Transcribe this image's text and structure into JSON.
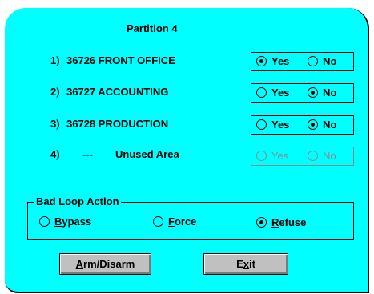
{
  "title": "Partition 4",
  "rows": [
    {
      "num": "1)",
      "label": "36726 FRONT OFFICE",
      "yes": "Yes",
      "no": "No",
      "selected": "yes"
    },
    {
      "num": "2)",
      "label": "36727 ACCOUNTING",
      "yes": "Yes",
      "no": "No",
      "selected": "no"
    },
    {
      "num": "3)",
      "label": "36728 PRODUCTION",
      "yes": "Yes",
      "no": "No",
      "selected": "no"
    },
    {
      "num": "4)",
      "dashes": "---",
      "label": "Unused Area",
      "yes": "Yes",
      "no": "No",
      "selected": "none",
      "disabled": true
    }
  ],
  "bad_loop": {
    "legend": "Bad Loop Action",
    "options": [
      {
        "label": "Bypass",
        "mnemonic": "B",
        "rest": "ypass"
      },
      {
        "label": "Force",
        "mnemonic": "F",
        "rest": "orce"
      },
      {
        "label": "Refuse",
        "mnemonic": "R",
        "rest": "efuse"
      }
    ],
    "selected": "Refuse"
  },
  "buttons": {
    "arm": {
      "label": "Arm/Disarm",
      "mnemonic": "A",
      "rest": "rm/Disarm"
    },
    "exit": {
      "label": "Exit",
      "pre": "E",
      "mnemonic": "x",
      "rest": "it"
    }
  },
  "colors": {
    "background": "#00ffff",
    "button": "#c0c0c0",
    "disabled_text": "#8a8a8a"
  }
}
